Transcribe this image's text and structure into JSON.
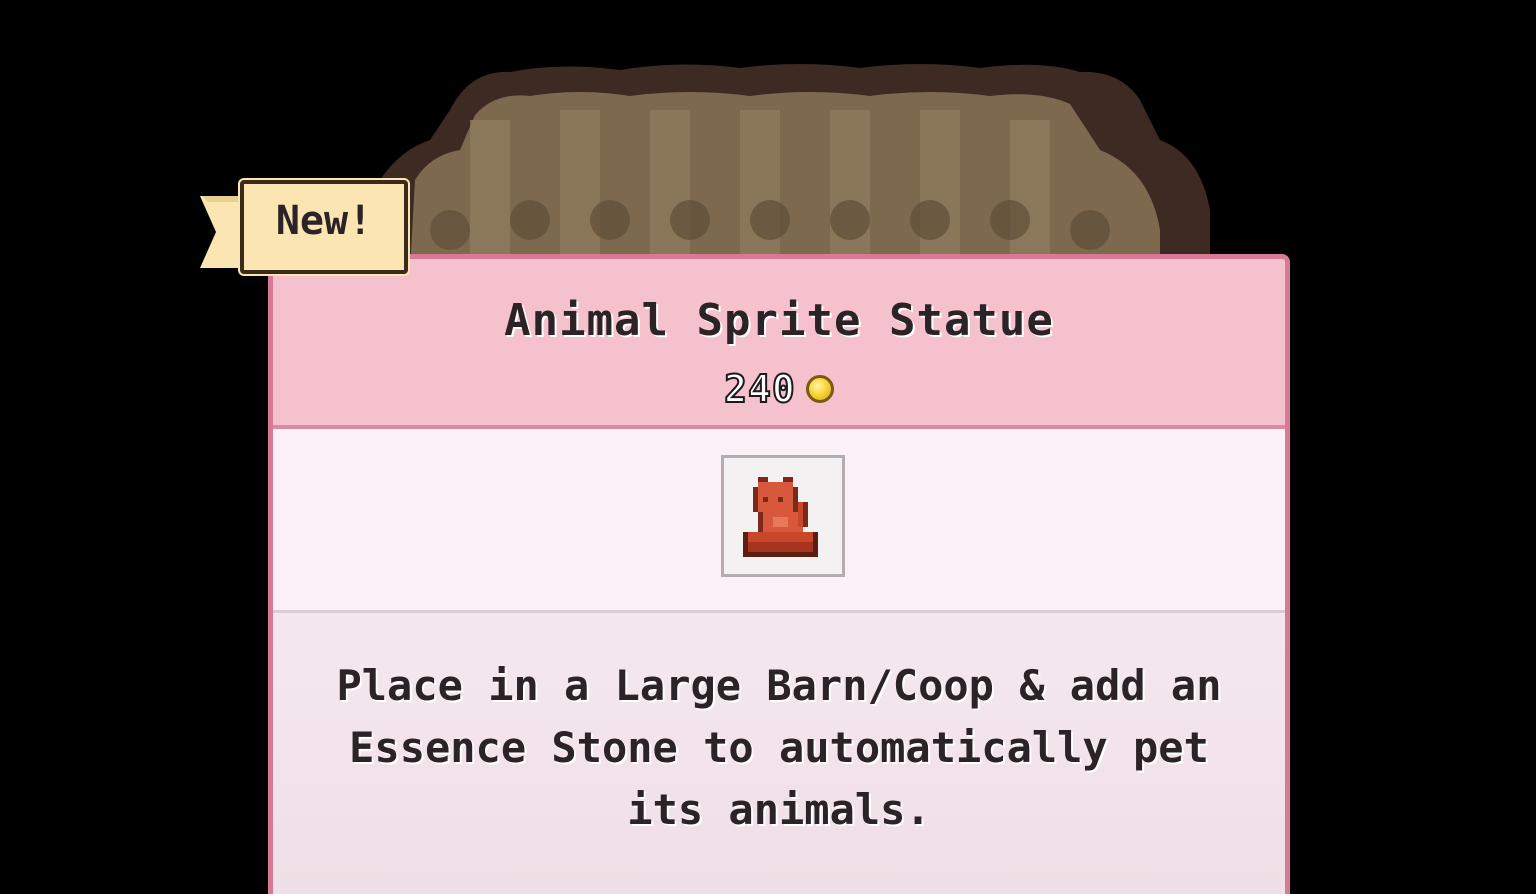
{
  "badge": {
    "label": "New!"
  },
  "item": {
    "name": "Animal Sprite Statue",
    "price": "240",
    "currency_icon": "gold-coin-icon",
    "image_icon": "animal-sprite-statue-icon",
    "description": "Place in a Large Barn/Coop & add an Essence Stone to automatically pet its animals."
  },
  "colors": {
    "header_bg": "#f4c1cd",
    "card_border": "#d87a96",
    "badge_bg": "#fbe5b3",
    "coin": "#f8d53a",
    "statue": "#d7583a"
  }
}
